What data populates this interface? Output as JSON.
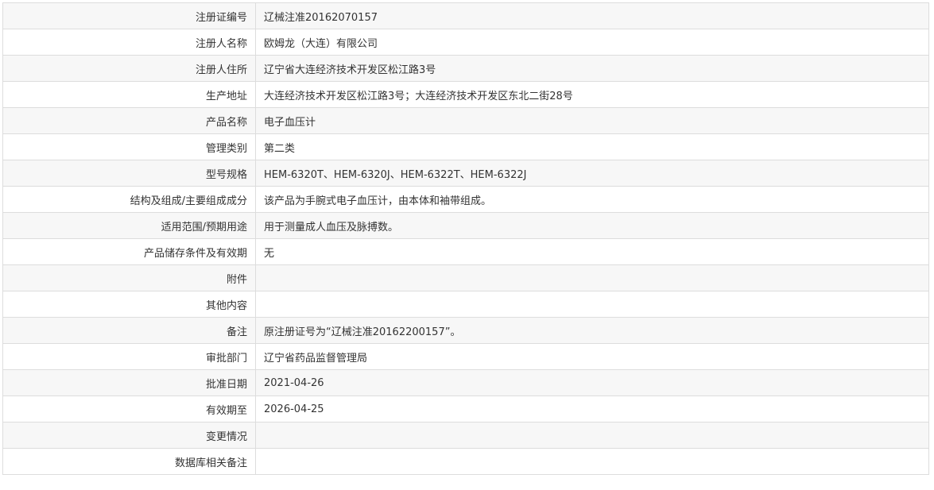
{
  "record": {
    "rows": [
      {
        "label": "注册证编号",
        "value": "辽械注准20162070157"
      },
      {
        "label": "注册人名称",
        "value": "欧姆龙（大连）有限公司"
      },
      {
        "label": "注册人住所",
        "value": "辽宁省大连经济技术开发区松江路3号"
      },
      {
        "label": "生产地址",
        "value": "大连经济技术开发区松江路3号；大连经济技术开发区东北二街28号"
      },
      {
        "label": "产品名称",
        "value": "电子血压计"
      },
      {
        "label": "管理类别",
        "value": "第二类"
      },
      {
        "label": "型号规格",
        "value": "HEM-6320T、HEM-6320J、HEM-6322T、HEM-6322J"
      },
      {
        "label": "结构及组成/主要组成成分",
        "value": "该产品为手腕式电子血压计，由本体和袖带组成。"
      },
      {
        "label": "适用范围/预期用途",
        "value": "用于测量成人血压及脉搏数。"
      },
      {
        "label": "产品储存条件及有效期",
        "value": "无"
      },
      {
        "label": "附件",
        "value": ""
      },
      {
        "label": "其他内容",
        "value": ""
      },
      {
        "label": "备注",
        "value": "原注册证号为“辽械注准20162200157”。"
      },
      {
        "label": "审批部门",
        "value": "辽宁省药品监督管理局"
      },
      {
        "label": "批准日期",
        "value": "2021-04-26"
      },
      {
        "label": "有效期至",
        "value": "2026-04-25"
      },
      {
        "label": "变更情况",
        "value": ""
      },
      {
        "label": "数据库相关备注",
        "value": ""
      }
    ]
  }
}
